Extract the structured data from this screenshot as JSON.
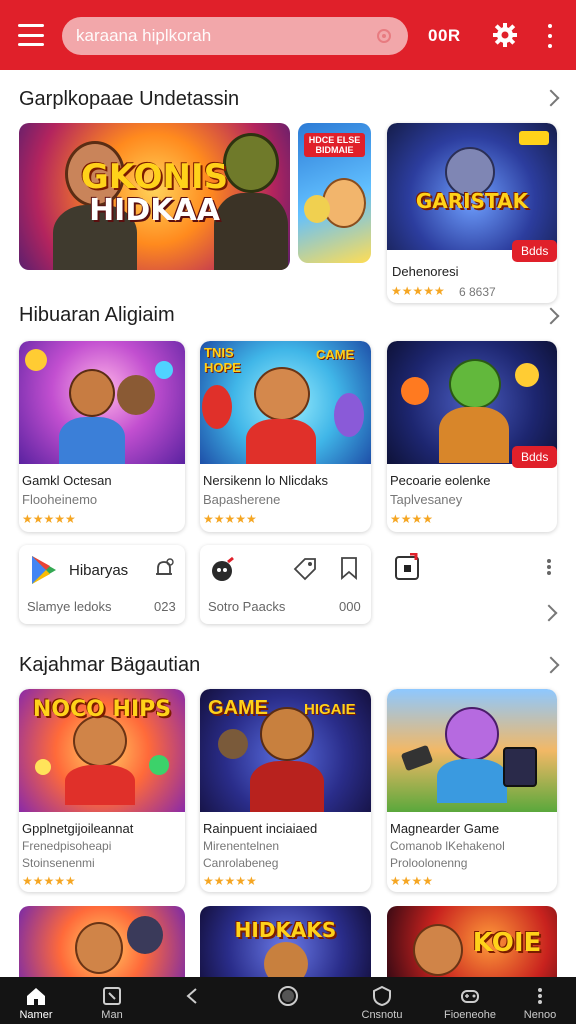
{
  "header": {
    "search_placeholder": "karaana hiplkorah",
    "coins": "00R",
    "accent": "#e0202a"
  },
  "section1": {
    "title": "Garplkopaae Undetassin",
    "featured": {
      "art_text_1": "GKONIS",
      "art_text_2": "HIDKAA"
    },
    "small_art_text": "HDCE ELSE BIDMAIE",
    "side": {
      "art_text": "GARISTAK",
      "badge": "Bdds",
      "title": "Dehenoresi",
      "stars": "★★★★★",
      "rating": "6 8637"
    }
  },
  "section2": {
    "title": "Hibuaran Aligiaim",
    "cards": [
      {
        "title": "Gamkl Octesan",
        "sub": "Flooheinemo",
        "stars": "★★★★★"
      },
      {
        "title": "Nersikenn lo Nlicdaks",
        "sub": "Bapasherene",
        "stars": "★★★★★",
        "art_text_1": "TNIS HOPE",
        "art_text_2": "CAME"
      },
      {
        "title": "Pecoarie eolenke",
        "sub": "Taplvesaney",
        "stars": "★★★★",
        "badge": "Bdds"
      }
    ]
  },
  "app_row": {
    "items": [
      {
        "label": "Hibaryas",
        "sub": "Slamye ledoks",
        "num": "023"
      },
      {
        "sub": "Sotro Paacks",
        "num": "000"
      }
    ]
  },
  "section3": {
    "title": "Kajahmar Bägautian",
    "cards": [
      {
        "title": "Gpplnetgijoileannat",
        "sub1": "Frenedpisoheapi",
        "sub2": "Stoinsenenmi",
        "stars": "★★★★★",
        "art_text": "NOCO HIPS"
      },
      {
        "title": "Rainpuent inciaiaed",
        "sub1": "Mirenentelnen",
        "sub2": "Canrolabeneg",
        "stars": "★★★★★",
        "art_text_1": "GAME",
        "art_text_2": "HIGAIE"
      },
      {
        "title": "Magnearder Game",
        "sub1": "Comanob lKehakenol",
        "sub2": "Proloolonenng",
        "stars": "★★★★"
      }
    ]
  },
  "section4": {
    "art_texts": [
      "HIDKAKS",
      "KOIE"
    ]
  },
  "bottom_nav": [
    {
      "label": "Namer",
      "icon": "home-icon"
    },
    {
      "label": "Man",
      "icon": "library-icon"
    },
    {
      "label": "",
      "icon": "back-icon"
    },
    {
      "label": "",
      "icon": "circle-icon"
    },
    {
      "label": "Cnsnotu",
      "icon": "shield-icon"
    },
    {
      "label": "Fioeneohe",
      "icon": "gamepad-icon"
    },
    {
      "label": "Nenoo",
      "icon": "more-icon"
    }
  ]
}
